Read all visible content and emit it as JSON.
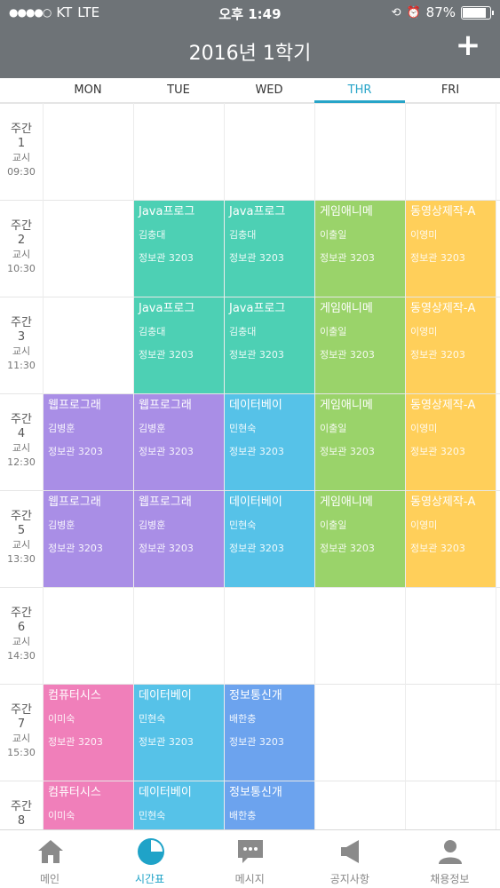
{
  "status_bar": {
    "signal": "●●●●○",
    "carrier": "KT",
    "network": "LTE",
    "time": "오후 1:49",
    "battery_text": "87%",
    "battery_level": 0.87
  },
  "header": {
    "title": "2016년 1학기",
    "add_label": "+"
  },
  "days": [
    {
      "label": "MON",
      "active": false
    },
    {
      "label": "TUE",
      "active": false
    },
    {
      "label": "WED",
      "active": false
    },
    {
      "label": "THR",
      "active": true
    },
    {
      "label": "FRI",
      "active": false
    }
  ],
  "periods": [
    {
      "a": "주간",
      "num": "1",
      "b": "교시",
      "time": "09:30"
    },
    {
      "a": "주간",
      "num": "2",
      "b": "교시",
      "time": "10:30"
    },
    {
      "a": "주간",
      "num": "3",
      "b": "교시",
      "time": "11:30"
    },
    {
      "a": "주간",
      "num": "4",
      "b": "교시",
      "time": "12:30"
    },
    {
      "a": "주간",
      "num": "5",
      "b": "교시",
      "time": "13:30"
    },
    {
      "a": "주간",
      "num": "6",
      "b": "교시",
      "time": "14:30"
    },
    {
      "a": "주간",
      "num": "7",
      "b": "교시",
      "time": "15:30"
    },
    {
      "a": "주간",
      "num": "8",
      "b": "",
      "time": ""
    }
  ],
  "colors": {
    "teal": "#4dd0b4",
    "green": "#9ad36a",
    "yellow": "#ffcf5a",
    "purple": "#a98ee6",
    "blue": "#56c2e8",
    "pink": "#f07fba",
    "royal": "#6ca3ee",
    "active": "#27a4c8"
  },
  "classes": [
    {
      "day": 1,
      "period": 1,
      "title": "Java프로그",
      "prof": "김충대",
      "room": "정보관 3203",
      "color": "teal"
    },
    {
      "day": 2,
      "period": 1,
      "title": "Java프로그",
      "prof": "김충대",
      "room": "정보관 3203",
      "color": "teal"
    },
    {
      "day": 3,
      "period": 1,
      "title": "게임애니메",
      "prof": "이출일",
      "room": "정보관 3203",
      "color": "green"
    },
    {
      "day": 4,
      "period": 1,
      "title": "동영상제작-A",
      "prof": "이영미",
      "room": "정보관 3203",
      "color": "yellow"
    },
    {
      "day": 1,
      "period": 2,
      "title": "Java프로그",
      "prof": "김충대",
      "room": "정보관 3203",
      "color": "teal"
    },
    {
      "day": 2,
      "period": 2,
      "title": "Java프로그",
      "prof": "김충대",
      "room": "정보관 3203",
      "color": "teal"
    },
    {
      "day": 3,
      "period": 2,
      "title": "게임애니메",
      "prof": "이출일",
      "room": "정보관 3203",
      "color": "green"
    },
    {
      "day": 4,
      "period": 2,
      "title": "동영상제작-A",
      "prof": "이영미",
      "room": "정보관 3203",
      "color": "yellow"
    },
    {
      "day": 0,
      "period": 3,
      "title": "웹프로그래",
      "prof": "김병훈",
      "room": "정보관 3203",
      "color": "purple"
    },
    {
      "day": 1,
      "period": 3,
      "title": "웹프로그래",
      "prof": "김병훈",
      "room": "정보관 3203",
      "color": "purple"
    },
    {
      "day": 2,
      "period": 3,
      "title": "데이터베이",
      "prof": "민현숙",
      "room": "정보관 3203",
      "color": "blue"
    },
    {
      "day": 3,
      "period": 3,
      "title": "게임애니메",
      "prof": "이출일",
      "room": "정보관 3203",
      "color": "green"
    },
    {
      "day": 4,
      "period": 3,
      "title": "동영상제작-A",
      "prof": "이영미",
      "room": "정보관 3203",
      "color": "yellow"
    },
    {
      "day": 0,
      "period": 4,
      "title": "웹프로그래",
      "prof": "김병훈",
      "room": "정보관 3203",
      "color": "purple"
    },
    {
      "day": 1,
      "period": 4,
      "title": "웹프로그래",
      "prof": "김병훈",
      "room": "정보관 3203",
      "color": "purple"
    },
    {
      "day": 2,
      "period": 4,
      "title": "데이터베이",
      "prof": "민현숙",
      "room": "정보관 3203",
      "color": "blue"
    },
    {
      "day": 3,
      "period": 4,
      "title": "게임애니메",
      "prof": "이출일",
      "room": "정보관 3203",
      "color": "green"
    },
    {
      "day": 4,
      "period": 4,
      "title": "동영상제작-A",
      "prof": "이영미",
      "room": "정보관 3203",
      "color": "yellow"
    },
    {
      "day": 0,
      "period": 6,
      "title": "컴퓨터시스",
      "prof": "이미숙",
      "room": "정보관 3203",
      "color": "pink"
    },
    {
      "day": 1,
      "period": 6,
      "title": "데이터베이",
      "prof": "민현숙",
      "room": "정보관 3203",
      "color": "blue"
    },
    {
      "day": 2,
      "period": 6,
      "title": "정보통신개",
      "prof": "배한충",
      "room": "정보관 3203",
      "color": "royal"
    },
    {
      "day": 0,
      "period": 7,
      "title": "컴퓨터시스",
      "prof": "이미숙",
      "room": "",
      "color": "pink"
    },
    {
      "day": 1,
      "period": 7,
      "title": "데이터베이",
      "prof": "민현숙",
      "room": "",
      "color": "blue"
    },
    {
      "day": 2,
      "period": 7,
      "title": "정보통신개",
      "prof": "배한충",
      "room": "",
      "color": "royal"
    }
  ],
  "tabs": [
    {
      "label": "메인",
      "icon": "home-icon",
      "active": false
    },
    {
      "label": "시간표",
      "icon": "timetable-pie-icon",
      "active": true
    },
    {
      "label": "메시지",
      "icon": "message-icon",
      "active": false
    },
    {
      "label": "공지사항",
      "icon": "megaphone-icon",
      "active": false
    },
    {
      "label": "채용정보",
      "icon": "person-icon",
      "active": false
    }
  ]
}
